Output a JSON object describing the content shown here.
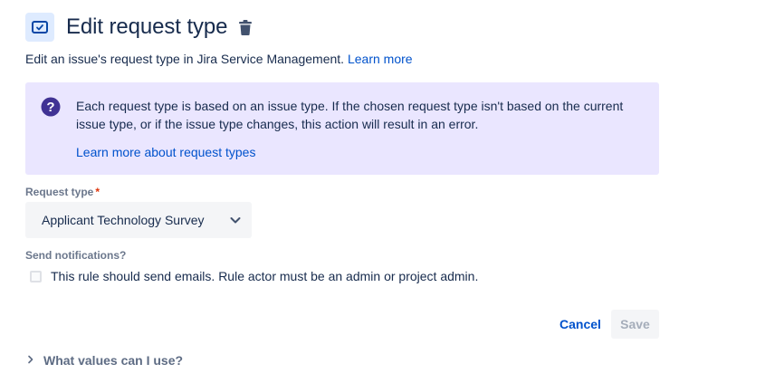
{
  "header": {
    "icon": "request-type-icon",
    "title": "Edit request type",
    "delete_icon": "trash-icon"
  },
  "description": {
    "text": "Edit an issue's request type in Jira Service Management.",
    "link": "Learn more"
  },
  "info_panel": {
    "icon": "question-circle-icon",
    "text": "Each request type is based on an issue type. If the chosen request type isn't based on the current issue type, or if the issue type changes, this action will result in an error.",
    "link": "Learn more about request types"
  },
  "request_type": {
    "label": "Request type",
    "required_marker": "*",
    "value": "Applicant Technology Survey"
  },
  "notifications": {
    "label": "Send notifications?",
    "checkbox_label": "This rule should send emails. Rule actor must be an admin or project admin.",
    "checked": false
  },
  "actions": {
    "cancel": "Cancel",
    "save": "Save"
  },
  "help": {
    "label": "What values can I use?"
  },
  "colors": {
    "accent": "#0052cc",
    "info_background": "#eae6ff",
    "info_icon": "#403294",
    "required": "#de350b"
  }
}
